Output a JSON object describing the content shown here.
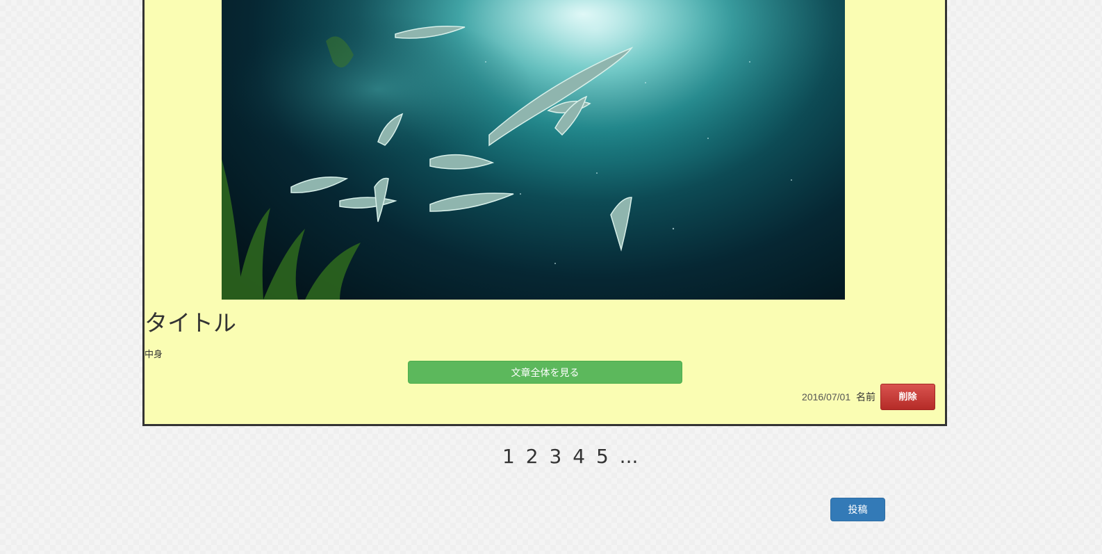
{
  "post": {
    "title": "タイトル",
    "body": "中身",
    "read_more_label": "文章全体を見る",
    "date": "2016/07/01",
    "author": "名前",
    "delete_label": "削除",
    "image_alt": "underwater-fish-photo"
  },
  "pagination": {
    "pages": [
      "1",
      "2",
      "3",
      "4",
      "5"
    ],
    "ellipsis": "..."
  },
  "actions": {
    "submit_label": "投稿"
  },
  "colors": {
    "card_bg": "#fafdb3",
    "card_border": "#333333",
    "read_more": "#5cb85c",
    "delete": "#d9534f",
    "submit": "#337ab7"
  }
}
